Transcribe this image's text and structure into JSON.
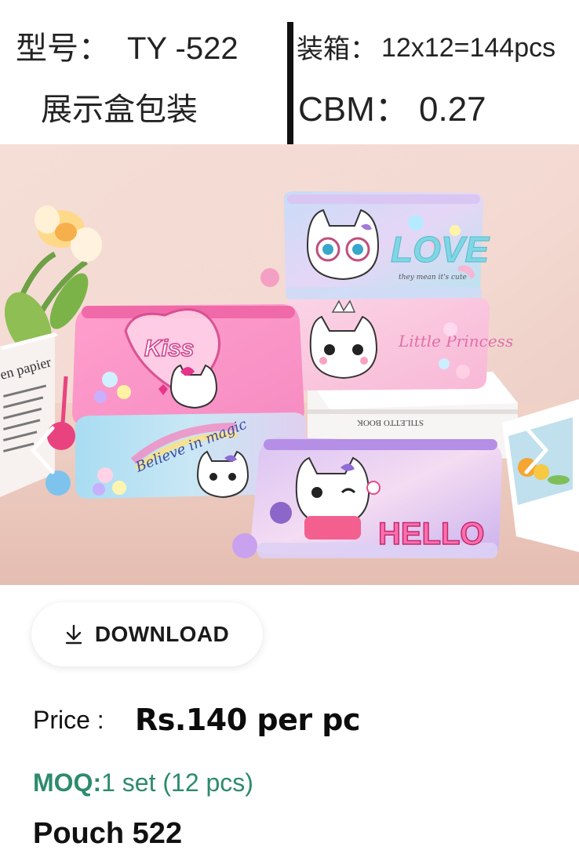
{
  "spec": {
    "model_label": "型号：",
    "model_value": "TY -522",
    "packing_label": "装箱：",
    "packing_value": "12x12=144pcs",
    "display_box": "展示盒包装",
    "cbm_label": "CBM：",
    "cbm_value": "0.27"
  },
  "gallery": {
    "image_text": {
      "book_label": "en papier",
      "pouch_love": "LOVE",
      "pouch_love_sub": "they mean it's cute",
      "pouch_kiss": "Kiss",
      "pouch_princess": "Little Princess",
      "pouch_believe": "Believe in magic",
      "pouch_hello": "HELLO",
      "book_spine": "STILETTO BOOK"
    },
    "prev_icon": "chevron-left-icon",
    "next_icon": "chevron-right-icon"
  },
  "download": {
    "label": "DOWNLOAD",
    "icon": "download-icon"
  },
  "product": {
    "price_label": "Price :",
    "price_value": "Rs.140 per pc",
    "moq_label": "MOQ:",
    "moq_value": "1 set (12 pcs)",
    "name": "Pouch 522"
  },
  "colors": {
    "moq_green": "#2e8b6a",
    "pink": "#f7a6cf",
    "lilac": "#c8a6ef",
    "sky": "#a9d6f5"
  }
}
